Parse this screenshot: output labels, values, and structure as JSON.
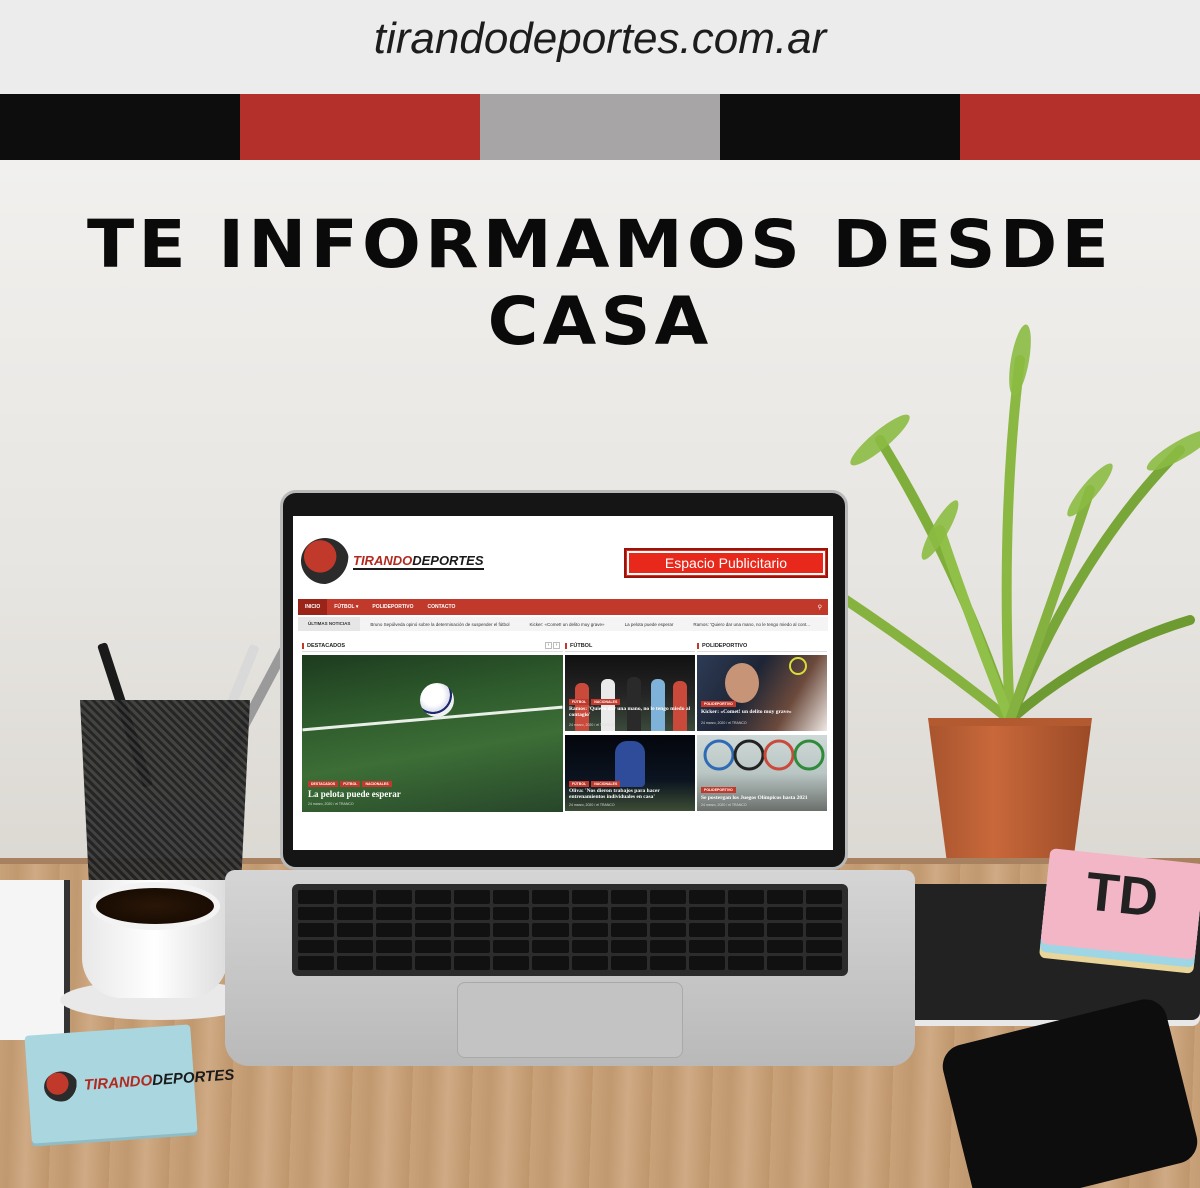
{
  "header": {
    "site_url": "tirandodeportes.com.ar",
    "headline": "TE INFORMAMOS DESDE CASA"
  },
  "stripe_colors": [
    "#0d0d0d",
    "#b4302a",
    "#a7a5a6",
    "#0d0d0d",
    "#b4302a"
  ],
  "colors": {
    "brand_red": "#c0392b",
    "brand_dark": "#1a1a1a",
    "ad_red": "#e8281a"
  },
  "website": {
    "logo": {
      "part1": "TIRANDO",
      "part2": "DEPORTES"
    },
    "ad_label": "Espacio Publicitario",
    "nav": {
      "items": [
        "INICIO",
        "FÚTBOL ▾",
        "POLIDEPORTIVO",
        "CONTACTO"
      ],
      "search_icon": "search-icon"
    },
    "ticker": {
      "label": "ÚLTIMAS NOTICIAS",
      "items": [
        "Bruno Sepúlveda opinó sobre la determinación de suspender el fútbol",
        "Kicker: «Comet! un delito muy grave»",
        "La pelota puede esperar",
        "Ramos: 'Quiero dar una mano, no le tengo miedo al cont..."
      ]
    },
    "sections": {
      "destacados": "DESTACADOS",
      "futbol": "FÚTBOL",
      "polideportivo": "POLIDEPORTIVO"
    },
    "featured": {
      "tags": [
        "DESTACADOS",
        "FÚTBOL",
        "NACIONALES"
      ],
      "title": "La pelota puede esperar",
      "meta": "24 marzo, 2020 / el TRANCO"
    },
    "posts": [
      {
        "tags": [
          "FÚTBOL",
          "NACIONALES"
        ],
        "title": "Ramos: 'Quiero dar una mano, no le tengo miedo al contagio'",
        "meta": "24 marzo, 2020 / el TRANCO"
      },
      {
        "tags": [
          "POLIDEPORTIVO"
        ],
        "title": "Kicker: «Comet! un delito muy grave»",
        "meta": "24 marzo, 2020 / el TRANCO"
      },
      {
        "tags": [
          "FÚTBOL",
          "NACIONALES"
        ],
        "title": "Oliva: 'Nos dieron trabajos para hacer entrenamientos individuales en casa'",
        "meta": "24 marzo, 2020 / el TRANCO"
      },
      {
        "tags": [
          "POLIDEPORTIVO"
        ],
        "title": "Se postergan los Juegos Olímpicos hasta 2021",
        "meta": "24 marzo, 2020 / el TRANCO"
      }
    ]
  },
  "props": {
    "sticky_logo": {
      "part1": "TIRANDO",
      "part2": "DEPORTES"
    },
    "pad_letters": "TD"
  }
}
